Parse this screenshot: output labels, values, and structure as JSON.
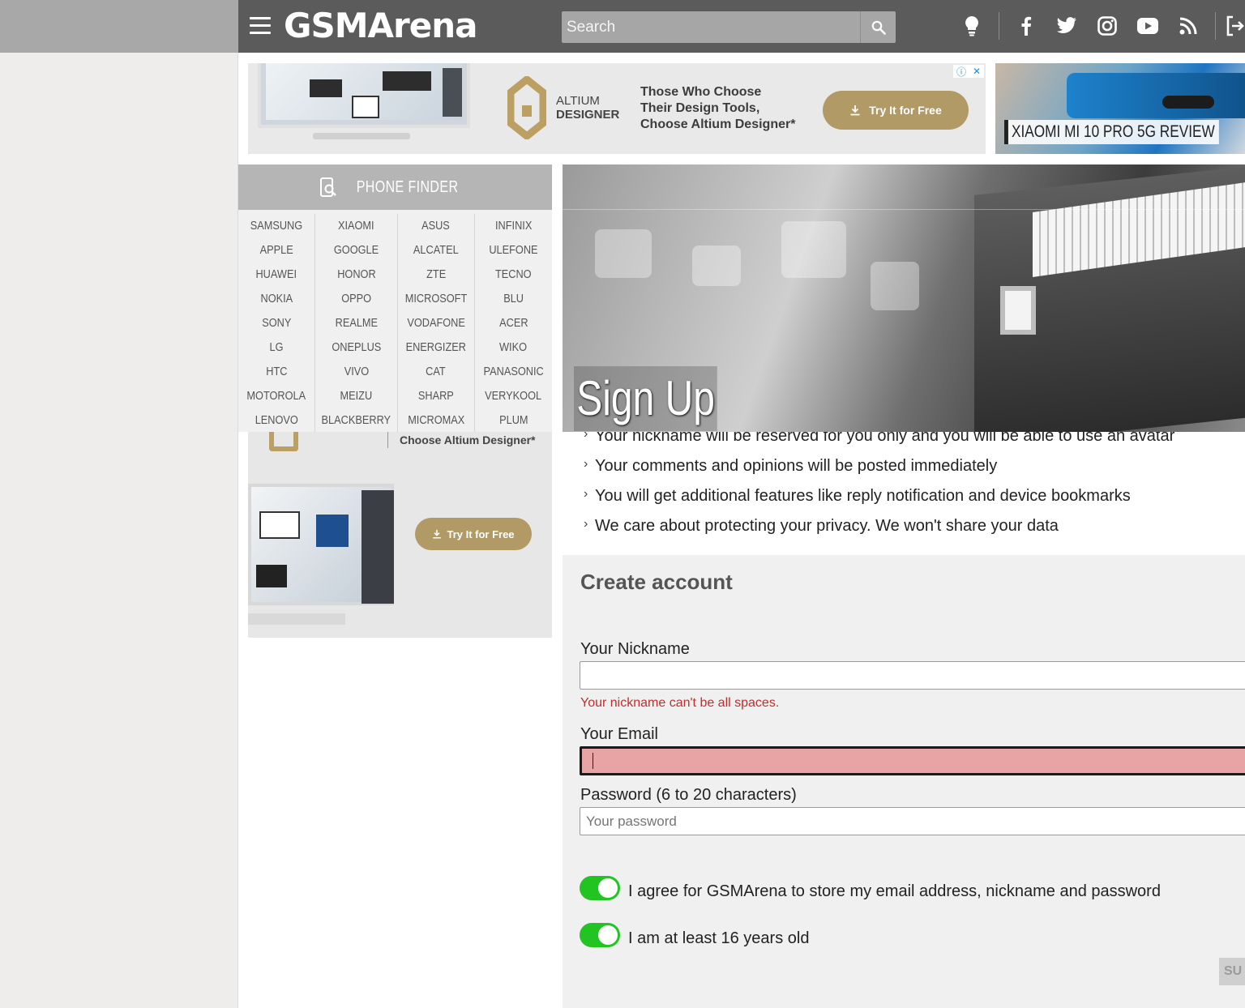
{
  "header": {
    "logo": "GSMArena",
    "search_placeholder": "Search",
    "icons": [
      "lightbulb-icon",
      "facebook-icon",
      "twitter-icon",
      "instagram-icon",
      "youtube-icon",
      "rss-icon",
      "login-icon"
    ]
  },
  "ad_top": {
    "brand_line1": "ALTIUM",
    "brand_line2": "DESIGNER",
    "copy_line1": "Those Who Choose",
    "copy_line2": "Their Design Tools,",
    "copy_line3": "Choose Altium Designer*",
    "cta": "Try It for Free"
  },
  "featured": {
    "label": "XIAOMI MI 10 PRO 5G REVIEW"
  },
  "phone_finder": {
    "title": "PHONE FINDER",
    "brands": [
      "SAMSUNG",
      "XIAOMI",
      "ASUS",
      "INFINIX",
      "APPLE",
      "GOOGLE",
      "ALCATEL",
      "ULEFONE",
      "HUAWEI",
      "HONOR",
      "ZTE",
      "TECNO",
      "NOKIA",
      "OPPO",
      "MICROSOFT",
      "BLU",
      "SONY",
      "REALME",
      "VODAFONE",
      "ACER",
      "LG",
      "ONEPLUS",
      "ENERGIZER",
      "WIKO",
      "HTC",
      "VIVO",
      "CAT",
      "PANASONIC",
      "MOTOROLA",
      "MEIZU",
      "SHARP",
      "VERYKOOL",
      "LENOVO",
      "BLACKBERRY",
      "MICROMAX",
      "PLUM"
    ]
  },
  "ad_side": {
    "tagline": "Choose Altium Designer*",
    "cta": "Try It for Free"
  },
  "hero": {
    "title": "Sign Up"
  },
  "benefits": [
    "Your nickname will be reserved for you only and you will be able to use an avatar",
    "Your comments and opinions will be posted immediately",
    "You will get additional features like reply notification and device bookmarks",
    "We care about protecting your privacy. We won't share your data"
  ],
  "form": {
    "title": "Create account",
    "nickname_label": "Your Nickname",
    "nickname_value": "",
    "nickname_error": "Your nickname can't be all spaces.",
    "email_label": "Your Email",
    "email_value": "",
    "password_label": "Password (6 to 20 characters)",
    "password_placeholder": "Your password",
    "agree_store": "I agree for GSMArena to store my email address, nickname and password",
    "agree_age": "I am at least 16 years old",
    "submit_label": "SU"
  },
  "colors": {
    "header_bg": "#5b5b5b",
    "toggle_on": "#22c422",
    "error_text": "#c62b2b",
    "email_error_bg": "#e8a4a4",
    "ad_gold": "#b29a66"
  }
}
